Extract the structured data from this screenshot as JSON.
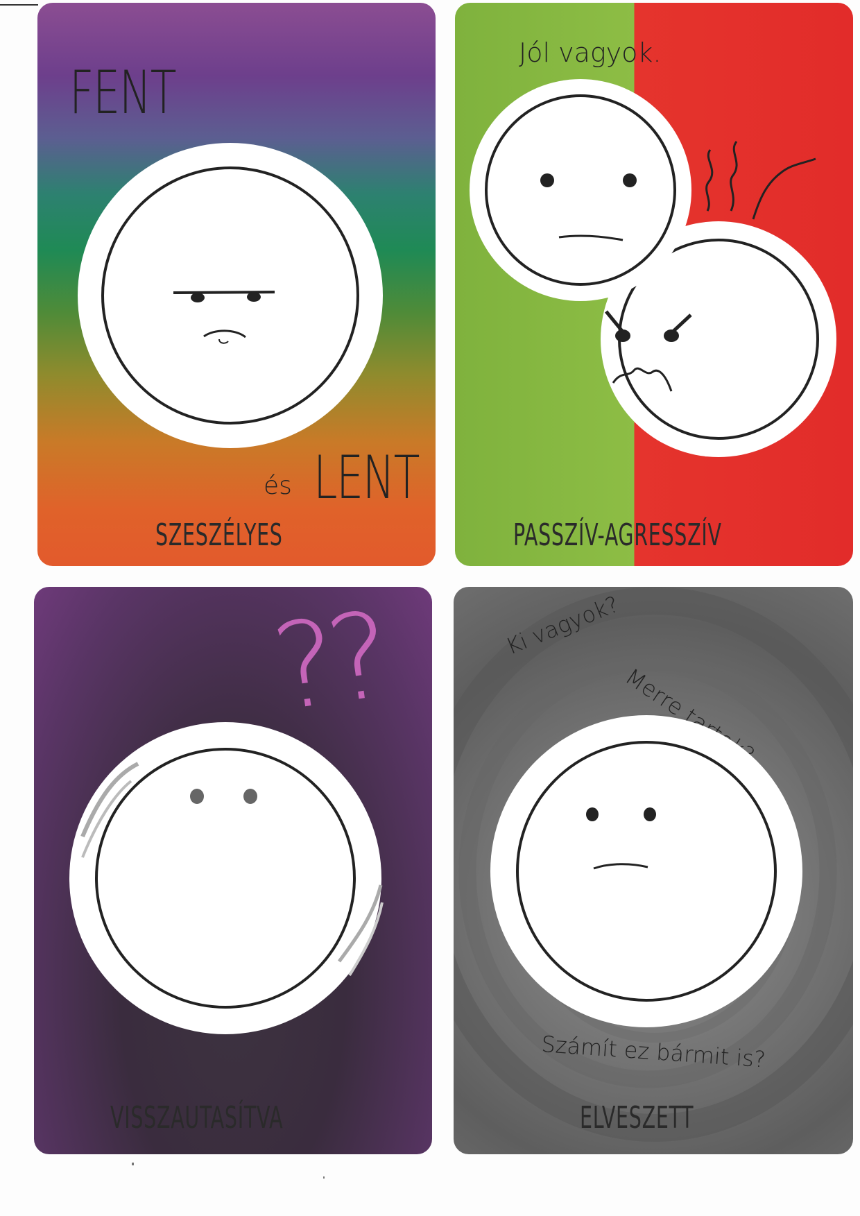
{
  "cards": [
    {
      "top_text": "FENT",
      "mid_small": "és",
      "mid_big": "LENT",
      "caption": "SZESZÉLYES"
    },
    {
      "top_text": "Jól vagyok.",
      "caption": "PASSZÍV-AGRESSZÍV"
    },
    {
      "symbol": "??",
      "caption": "VISSZAUTASÍTVA"
    },
    {
      "question1": "Ki vagyok?",
      "question2": "Merre tartok?",
      "question3": "Számít ez bármit is?",
      "caption": "ELVESZETT"
    }
  ],
  "colors": {
    "card1_gradient": [
      "#8b4d92",
      "#2d8170",
      "#1f8a55",
      "#c97a28",
      "#e25a2c"
    ],
    "card2_left": "#8dbd45",
    "card2_right": "#e22c2a",
    "card3": "#3a2c3e",
    "card3_accent": "#c464b8",
    "card4": "#777777"
  }
}
